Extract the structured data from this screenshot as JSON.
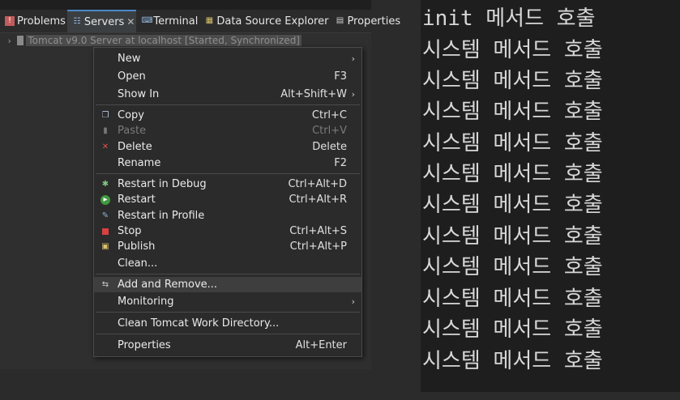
{
  "tabs": [
    {
      "label": "Problems",
      "icon": "problems-icon",
      "active": false
    },
    {
      "label": "Servers",
      "icon": "servers-icon",
      "active": true
    },
    {
      "label": "Terminal",
      "icon": "terminal-icon",
      "active": false
    },
    {
      "label": "Data Source Explorer",
      "icon": "data-source-icon",
      "active": false
    },
    {
      "label": "Properties",
      "icon": "properties-icon",
      "active": false
    }
  ],
  "server_row": {
    "label": "Tomcat v9.0 Server at localhost  [Started, Synchronized]"
  },
  "menu": {
    "new": {
      "label": "New"
    },
    "open": {
      "label": "Open",
      "accel": "F3"
    },
    "show_in": {
      "label": "Show In",
      "accel": "Alt+Shift+W"
    },
    "copy": {
      "label": "Copy",
      "accel": "Ctrl+C"
    },
    "paste": {
      "label": "Paste",
      "accel": "Ctrl+V"
    },
    "delete": {
      "label": "Delete",
      "accel": "Delete"
    },
    "rename": {
      "label": "Rename",
      "accel": "F2"
    },
    "restart_debug": {
      "label": "Restart in Debug",
      "accel": "Ctrl+Alt+D"
    },
    "restart": {
      "label": "Restart",
      "accel": "Ctrl+Alt+R"
    },
    "restart_profile": {
      "label": "Restart in Profile"
    },
    "stop": {
      "label": "Stop",
      "accel": "Ctrl+Alt+S"
    },
    "publish": {
      "label": "Publish",
      "accel": "Ctrl+Alt+P"
    },
    "clean": {
      "label": "Clean..."
    },
    "add_remove": {
      "label": "Add and Remove..."
    },
    "monitoring": {
      "label": "Monitoring"
    },
    "clean_work": {
      "label": "Clean Tomcat Work Directory..."
    },
    "properties": {
      "label": "Properties",
      "accel": "Alt+Enter"
    }
  },
  "console": {
    "lines": [
      "init 메서드 호출",
      "시스템 메서드 호출",
      "시스템 메서드 호출",
      "시스템 메서드 호출",
      "시스템 메서드 호출",
      "시스템 메서드 호출",
      "시스템 메서드 호출",
      "시스템 메서드 호출",
      "시스템 메서드 호출",
      "시스템 메서드 호출",
      "시스템 메서드 호출",
      "시스템 메서드 호출"
    ]
  }
}
